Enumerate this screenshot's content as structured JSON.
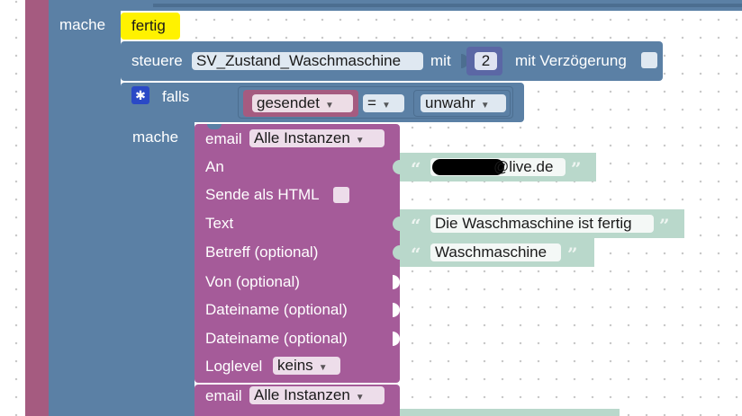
{
  "event_block": {
    "label": "mache"
  },
  "done_block": {
    "label": "fertig"
  },
  "control_block": {
    "label": "steuere",
    "state_name": "SV_Zustand_Waschmaschine",
    "mit_label": "mit",
    "value": "2",
    "delay_label": "mit Verzögerung"
  },
  "if_block": {
    "label": "falls",
    "variable": "gesendet",
    "operator": "=",
    "compare_value": "unwahr",
    "do_label": "mache"
  },
  "email_block": {
    "label": "email",
    "instance": "Alle Instanzen",
    "fields": {
      "to": "An",
      "html": "Sende als HTML",
      "text": "Text",
      "subject": "Betreff (optional)",
      "from": "Von (optional)",
      "filename1": "Dateiname (optional)",
      "filename2": "Dateiname (optional)",
      "loglevel": "Loglevel"
    },
    "loglevel_value": "keins",
    "to_value": "@live.de",
    "text_value": "Die Waschmaschine ist fertig",
    "subject_value": "Waschmaschine"
  },
  "email_block_2": {
    "label": "email",
    "instance": "Alle Instanzen"
  },
  "icons": {
    "gear": "gear-icon",
    "dropdown": "▼",
    "quote_open": "“",
    "quote_close": "”"
  },
  "colors": {
    "event": "#5b80a5",
    "control": "#5b80a5",
    "email": "#a55b99",
    "text": "#b9d8cb",
    "highlight": "#fff200",
    "outer": "#a55b80"
  }
}
